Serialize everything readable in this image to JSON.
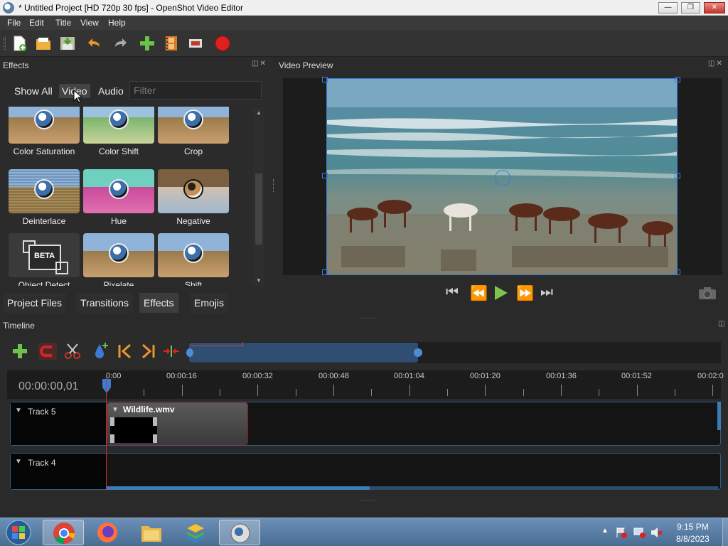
{
  "window": {
    "title": "* Untitled Project [HD 720p 30 fps] - OpenShot Video Editor",
    "minimize": "—",
    "maximize": "❒",
    "close": "✕"
  },
  "menu": {
    "file": "File",
    "edit": "Edit",
    "title": "Title",
    "view": "View",
    "help": "Help"
  },
  "toolbar": {
    "icons": [
      "new-project-icon",
      "open-project-icon",
      "save-project-icon",
      "undo-icon",
      "redo-icon",
      "import-files-icon",
      "profile-icon",
      "fullscreen-icon",
      "export-video-icon"
    ]
  },
  "effects_panel": {
    "title": "Effects",
    "filters": {
      "show_all": "Show All",
      "video": "Video",
      "audio": "Audio"
    },
    "filter_placeholder": "Filter",
    "items": [
      {
        "label": "Color Saturation"
      },
      {
        "label": "Color Shift"
      },
      {
        "label": "Crop"
      },
      {
        "label": "Deinterlace"
      },
      {
        "label": "Hue"
      },
      {
        "label": "Negative"
      },
      {
        "label": "Object Detect",
        "badge": "BETA"
      },
      {
        "label": "Pixelate"
      },
      {
        "label": "Shift"
      }
    ]
  },
  "bottom_tabs": {
    "project_files": "Project Files",
    "transitions": "Transitions",
    "effects": "Effects",
    "emojis": "Emojis"
  },
  "preview_panel": {
    "title": "Video Preview"
  },
  "timeline": {
    "title": "Timeline",
    "current_time": "00:00:00,01",
    "ruler_labels": [
      "0:00",
      "00:00:16",
      "00:00:32",
      "00:00:48",
      "00:01:04",
      "00:01:20",
      "00:01:36",
      "00:01:52",
      "00:02:0"
    ],
    "tracks": [
      {
        "name": "Track 5",
        "clip": "Wildlife.wmv"
      },
      {
        "name": "Track 4"
      }
    ]
  },
  "taskbar": {
    "apps": [
      "windows-start",
      "chrome",
      "firefox",
      "file-explorer",
      "bluestacks",
      "openshot"
    ],
    "time": "9:15 PM",
    "date": "8/8/2023"
  },
  "colors": {
    "accent": "#3a7bd5",
    "record": "#e02020",
    "import": "#6cc24a",
    "panel": "#2b2b2b"
  }
}
